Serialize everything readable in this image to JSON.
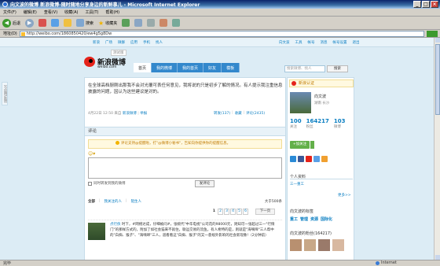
{
  "window": {
    "title": "向文波的微博 新浪微博-随时随地分享身边的新鲜事儿 - Microsoft Internet Explorer",
    "controls": [
      "_",
      "□",
      "×"
    ]
  },
  "menubar": [
    "文件(F)",
    "编辑(E)",
    "查看(V)",
    "收藏(A)",
    "工具(T)",
    "帮助(H)"
  ],
  "toolbar": {
    "back": "后退",
    "search": "搜索",
    "favorites": "收藏夹"
  },
  "address": {
    "label": "地址(D)",
    "url": "http://weibo.com/1860850420/ew4g5g8Dw"
  },
  "site": {
    "topnav_left": [
      "新浪",
      "广场",
      "微群",
      "应用",
      "手机",
      "找人"
    ],
    "topnav_right": [
      "向文波",
      "工具",
      "帐号",
      "消息",
      "帐号设置",
      "退出"
    ],
    "logo_text": "新浪微博",
    "logo_url": "weibo.com",
    "beta": "测试版",
    "nav": [
      "首页",
      "我的微博",
      "我的首页",
      "好友",
      "模板"
    ],
    "search_placeholder": "搜索微博、找人",
    "search_btn": "搜索"
  },
  "sidetab": "写应用反馈",
  "post": {
    "text": "在全球高档厨刚出那我不会对光覆可表任何意见，我将说的只是初步了解的情况。有人提示我注重信息披露的问题，因认为这些建议是对的。",
    "date": "4月22日 12:50 来自",
    "source": "新浪微博",
    "report": "举报",
    "forward": "转发(137)",
    "favorite": "收藏",
    "comment": "评论(2435)"
  },
  "comments": {
    "header": "评论",
    "notice": "评论支持@提醒啦，打\"@微博小秘书\"，告知向你提供你的提醒信息。",
    "sync_label": "同时转发到我的微博",
    "submit": "发评论",
    "filter_all": "全部",
    "filter_following": "我关注的人",
    "filter_stranger": "陌生人",
    "total": "大于500条",
    "pages": [
      "1",
      "2",
      "3",
      "4",
      "5",
      "6"
    ],
    "next": "下一页",
    "first": {
      "user": "点行侠",
      "text": "时下，#网络达成，仔细被问#，张婉代\"中华电视\"公司花的98000元，则知可一张超过三一\"行情门\"的那样方式的，附加了如社会猫来不就住，联运交易的流鱼。有人希特的是，则就是\"海嘀啼\"三人帮中的\"白痴、猴子\"、\"海嘀啼\"三人，道看看这\"白痴、猴子\"的又一意规外影响的社会新现象!（2分钟前）"
    }
  },
  "profile": {
    "badge": "新浪认证",
    "name": "向文波",
    "location": "湖南 长沙",
    "stats": [
      {
        "num": "100",
        "label": "关注"
      },
      {
        "num": "164217",
        "label": "粉丝"
      },
      {
        "num": "103",
        "label": "微博"
      }
    ],
    "follow": "+加关注",
    "tags_title": "个人资料",
    "tag_item": "三一重工",
    "more": "更多>>",
    "sec2_title": "向文波的标签",
    "tags": [
      "重工",
      "管理",
      "资源",
      "国际化"
    ],
    "fans_title": "向文波的粉丝(164217)"
  },
  "status": {
    "text": "完毕",
    "zone": "Internet"
  },
  "colors": {
    "brand_red": "#e5231a",
    "link_blue": "#0a7ec2",
    "nav_blue": "#3388cc",
    "page_bg": "#dcecf5"
  }
}
